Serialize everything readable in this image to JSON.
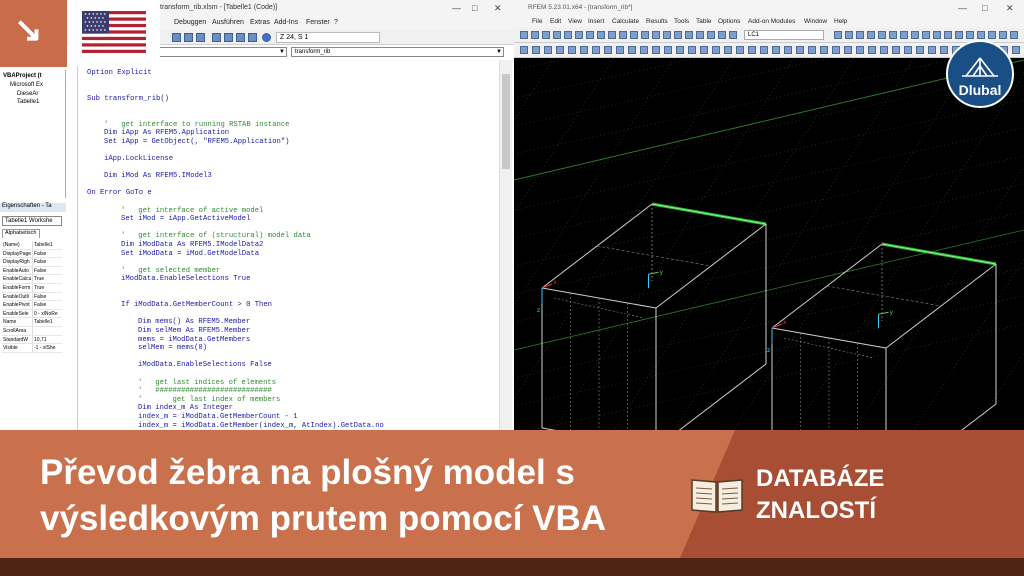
{
  "vba": {
    "title": "transform_rib.xlsm - [Tabelle1 (Code)]",
    "menu": [
      "Debuggen",
      "Ausführen",
      "Extras",
      "Add-Ins",
      "Fenster",
      "?"
    ],
    "position": "Z 24, S 1",
    "combo_left": "",
    "combo_right": "transform_rib",
    "project_tree": [
      "VBAProject (t",
      "Microsoft Ex",
      "DieseAr",
      "Tabelle1"
    ],
    "properties_header": "Eigenschaften - Ta",
    "properties_object": "Tabelle1 Workshe",
    "properties_tab": "Alphabetisch",
    "properties": [
      {
        "k": "(Name)",
        "v": "Tabelle1"
      },
      {
        "k": "DisplayPage",
        "v": "False"
      },
      {
        "k": "DisplayRigh",
        "v": "False"
      },
      {
        "k": "EnableAuto",
        "v": "False"
      },
      {
        "k": "EnableCalcu",
        "v": "True"
      },
      {
        "k": "EnableForm",
        "v": "True"
      },
      {
        "k": "EnableOutli",
        "v": "False"
      },
      {
        "k": "EnablePivot",
        "v": "False"
      },
      {
        "k": "EnableSele",
        "v": "0 - xlNoRe"
      },
      {
        "k": "Name",
        "v": "Tabelle1"
      },
      {
        "k": "ScrollArea",
        "v": ""
      },
      {
        "k": "StandardW",
        "v": "10,71"
      },
      {
        "k": "Visible",
        "v": "-1 - xlShe"
      }
    ],
    "code_lines": [
      {
        "t": "Option Explicit",
        "c": "kw",
        "ind": 0
      },
      {
        "t": "",
        "c": "pl",
        "ind": 0
      },
      {
        "t": "",
        "c": "pl",
        "ind": 0
      },
      {
        "t": "Sub transform_rib()",
        "c": "kw",
        "ind": 0
      },
      {
        "t": "",
        "c": "pl",
        "ind": 0
      },
      {
        "t": "",
        "c": "pl",
        "ind": 0
      },
      {
        "t": "'   get interface to running RSTAB instance",
        "c": "cm",
        "ind": 1
      },
      {
        "t": "Dim iApp As RFEM5.Application",
        "c": "kw",
        "ind": 1
      },
      {
        "t": "Set iApp = GetObject(, \"RFEM5.Application\")",
        "c": "kw",
        "ind": 1
      },
      {
        "t": "",
        "c": "pl",
        "ind": 0
      },
      {
        "t": "iApp.LockLicense",
        "c": "kw",
        "ind": 1
      },
      {
        "t": "",
        "c": "pl",
        "ind": 0
      },
      {
        "t": "Dim iMod As RFEM5.IModel3",
        "c": "kw",
        "ind": 1
      },
      {
        "t": "",
        "c": "pl",
        "ind": 0
      },
      {
        "t": "On Error GoTo e",
        "c": "kw",
        "ind": 0
      },
      {
        "t": "",
        "c": "pl",
        "ind": 0
      },
      {
        "t": "'   get interface of active model",
        "c": "cm",
        "ind": 2
      },
      {
        "t": "Set iMod = iApp.GetActiveModel",
        "c": "kw",
        "ind": 2
      },
      {
        "t": "",
        "c": "pl",
        "ind": 0
      },
      {
        "t": "'   get interface of (structural) model data",
        "c": "cm",
        "ind": 2
      },
      {
        "t": "Dim iModData As RFEM5.IModelData2",
        "c": "kw",
        "ind": 2
      },
      {
        "t": "Set iModData = iMod.GetModelData",
        "c": "kw",
        "ind": 2
      },
      {
        "t": "",
        "c": "pl",
        "ind": 0
      },
      {
        "t": "'   get selected member",
        "c": "cm",
        "ind": 2
      },
      {
        "t": "iModData.EnableSelections True",
        "c": "kw",
        "ind": 2
      },
      {
        "t": "",
        "c": "pl",
        "ind": 0
      },
      {
        "t": "",
        "c": "pl",
        "ind": 0
      },
      {
        "t": "If iModData.GetMemberCount > 0 Then",
        "c": "kw",
        "ind": 2
      },
      {
        "t": "",
        "c": "pl",
        "ind": 0
      },
      {
        "t": "Dim mems() As RFEM5.Member",
        "c": "kw",
        "ind": 3
      },
      {
        "t": "Dim selMem As RFEM5.Member",
        "c": "kw",
        "ind": 3
      },
      {
        "t": "mems = iModData.GetMembers",
        "c": "kw",
        "ind": 3
      },
      {
        "t": "selMem = mems(0)",
        "c": "kw",
        "ind": 3
      },
      {
        "t": "",
        "c": "pl",
        "ind": 0
      },
      {
        "t": "iModData.EnableSelections False",
        "c": "kw",
        "ind": 3
      },
      {
        "t": "",
        "c": "pl",
        "ind": 0
      },
      {
        "t": "'   get last indices of elements",
        "c": "cm",
        "ind": 3
      },
      {
        "t": "'   ###########################",
        "c": "cm",
        "ind": 3
      },
      {
        "t": "'       get last index of members",
        "c": "cm",
        "ind": 3
      },
      {
        "t": "Dim index_m As Integer",
        "c": "kw",
        "ind": 3
      },
      {
        "t": "index_m = iModData.GetMemberCount - 1",
        "c": "kw",
        "ind": 3
      },
      {
        "t": "index_m = iModData.GetMember(index_m, AtIndex).GetData.no",
        "c": "kw",
        "ind": 3
      }
    ]
  },
  "rfem": {
    "title": "RFEM 5.23.01.x64 - [transform_rib*]",
    "menu": [
      "File",
      "Edit",
      "View",
      "Insert",
      "Calculate",
      "Results",
      "Tools",
      "Table",
      "Options",
      "Add-on Modules",
      "Window",
      "Help"
    ],
    "load_case": "LC1",
    "axes": {
      "x": "x",
      "y": "y",
      "z": "z"
    }
  },
  "branding": {
    "logo": "Dlubal",
    "flag_icon": "us-flag-icon",
    "arrow_icon": "arrow-down-right-icon"
  },
  "banner": {
    "headline_line1": "Převod žebra na plošný model s",
    "headline_line2": "výsledkovým prutem pomocí VBA",
    "kb_line1": "DATABÁZE",
    "kb_line2": "ZNALOSTÍ",
    "book_icon": "open-book-icon"
  },
  "colors": {
    "banner_dark": "#a84e34",
    "banner_light": "#c9714d",
    "banner_bottom": "#4e2416",
    "dlubal_blue": "#1a4f86",
    "member_green": "#22c22a",
    "vba_keyword": "#1a1aa6",
    "vba_comment": "#2e8b2e"
  }
}
